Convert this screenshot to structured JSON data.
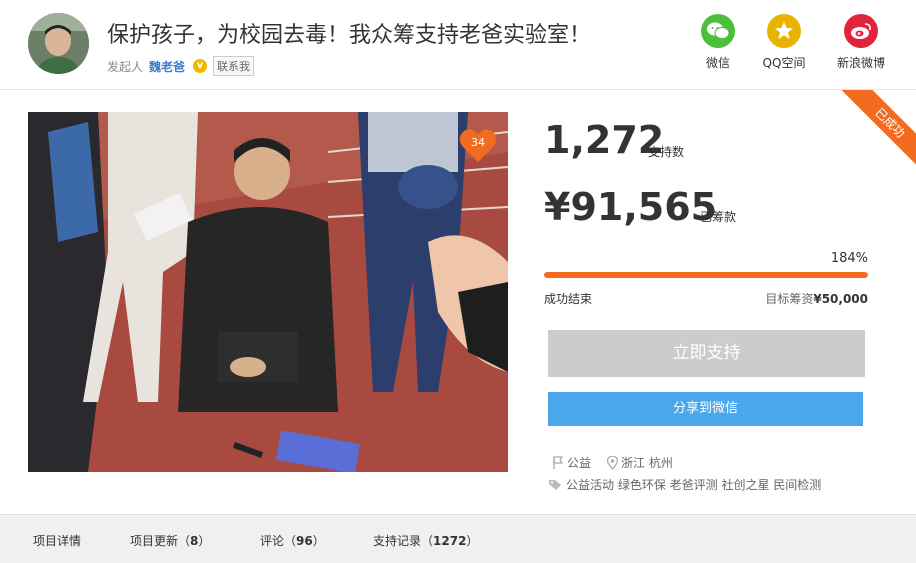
{
  "header": {
    "title": "保护孩子，为校园去毒！我众筹支持老爸实验室！",
    "sponsor_label": "发起人",
    "sponsor_name": "魏老爸",
    "verified_badge": "v",
    "contact_label": "联系我",
    "share": [
      {
        "label": "微信",
        "icon": "wechat-icon",
        "color": "#4cbf3a"
      },
      {
        "label": "QQ空间",
        "icon": "qzone-star-icon",
        "color": "#e9b400"
      },
      {
        "label": "新浪微博",
        "icon": "weibo-icon",
        "color": "#e0243c"
      }
    ]
  },
  "photo": {
    "likes": "34"
  },
  "ribbon": "已成功",
  "stats": {
    "supporters": "1,272",
    "supporters_label": "支持数",
    "raised": "¥91,565",
    "raised_label": "已筹款",
    "percent": "184%",
    "progress_fraction": 1.0,
    "status": "成功结束",
    "target_label": "目标筹资",
    "target_value": "¥50,000"
  },
  "buttons": {
    "support": "立即支持",
    "share_wechat": "分享到微信"
  },
  "meta": {
    "category": "公益",
    "location": "浙江 杭州",
    "tags": "公益活动 绿色环保 老爸评测 社创之星 民间检测"
  },
  "tabs": [
    {
      "label": "项目详情",
      "count": ""
    },
    {
      "label": "项目更新（",
      "count": "8",
      "end": "）"
    },
    {
      "label": "评论（",
      "count": "96",
      "end": "）"
    },
    {
      "label": "支持记录（",
      "count": "1272",
      "end": "）"
    }
  ],
  "colors": {
    "accent": "#f26b21",
    "button_blue": "#4aa7eb",
    "button_disabled": "#cccccc"
  }
}
